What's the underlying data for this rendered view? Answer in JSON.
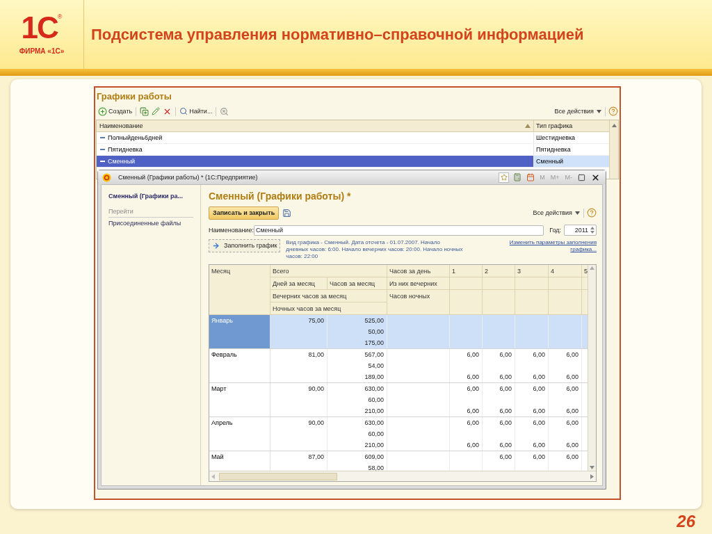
{
  "slide": {
    "logo_mark": "1С",
    "logo_registered": "®",
    "logo_caption": "ФИРМА «1С»",
    "title": "Подсистема управления нормативно–справочной информацией",
    "page_number": "26"
  },
  "list_form": {
    "title": "Графики работы",
    "toolbar": [
      [
        {
          "kind": "create",
          "label": "Создать"
        }
      ],
      [
        {
          "kind": "copy"
        },
        {
          "kind": "edit"
        },
        {
          "kind": "delete"
        }
      ],
      [
        {
          "kind": "find",
          "label": "Найти..."
        }
      ],
      [
        {
          "kind": "cancel_find"
        }
      ]
    ],
    "all_actions": "Все действия",
    "columns": [
      "Наименование",
      "Тип графика"
    ],
    "rows": [
      {
        "name": "Полныйдень6дней",
        "type": "Шестидневка",
        "selected": false
      },
      {
        "name": "Пятидневка",
        "type": "Пятидневка",
        "selected": false
      },
      {
        "name": "Сменный",
        "type": "Сменный",
        "selected": true
      }
    ]
  },
  "dialog": {
    "title": "Сменный (Графики работы) * (1С:Предприятие)",
    "tools": [
      {
        "kind": "favorite"
      },
      {
        "kind": "calculator"
      },
      {
        "kind": "calendar"
      },
      {
        "kind": "memory",
        "label": "M"
      },
      {
        "kind": "memory",
        "label": "M+"
      },
      {
        "kind": "memory",
        "label": "M-"
      },
      {
        "kind": "maximize"
      },
      {
        "kind": "close"
      }
    ],
    "nav": {
      "header": "Сменный (Графики ра...",
      "section": "Перейти",
      "links": [
        "Присоединенные файлы"
      ]
    },
    "form": {
      "heading": "Сменный (Графики работы) *",
      "save_close": "Записать и закрыть",
      "all_actions": "Все действия",
      "name_label": "Наименование:",
      "name_value": "Сменный",
      "year_label": "Год:",
      "year_value": "2011",
      "fill_button": "Заполнить график",
      "info": "Вид графика - Сменный. Дата отсчета - 01.07.2007. Начало дневных часов: 6:00. Начало вечерних часов: 20:00. Начало ночных часов: 22:00",
      "change_link": "Изменить параметры заполнения графика..."
    },
    "grid": {
      "header": {
        "month": "Месяц",
        "total": "Всего",
        "days": "Дней за месяц",
        "hours": "Часов за месяц",
        "evening_month": "Вечерних часов за месяц",
        "night_month": "Ночных часов за месяц",
        "per_day": "Часов за день",
        "evening": "Из них вечерних",
        "night": "Часов ночных",
        "day_columns": [
          "1",
          "2",
          "3",
          "4",
          "5"
        ]
      },
      "rows": [
        {
          "month": "Январь",
          "selected": true,
          "days": "75,00",
          "lines": [
            {
              "hours": "525,00"
            },
            {
              "hours": "50,00"
            },
            {
              "hours": "175,00"
            }
          ]
        },
        {
          "month": "Февраль",
          "selected": false,
          "days": "81,00",
          "lines": [
            {
              "hours": "567,00",
              "day": [
                "6,00",
                "6,00",
                "6,00",
                "6,00"
              ]
            },
            {
              "hours": "54,00"
            },
            {
              "hours": "189,00",
              "day": [
                "6,00",
                "6,00",
                "6,00",
                "6,00"
              ]
            }
          ]
        },
        {
          "month": "Март",
          "selected": false,
          "days": "90,00",
          "lines": [
            {
              "hours": "630,00",
              "day": [
                "6,00",
                "6,00",
                "6,00",
                "6,00"
              ]
            },
            {
              "hours": "60,00"
            },
            {
              "hours": "210,00",
              "day": [
                "6,00",
                "6,00",
                "6,00",
                "6,00"
              ]
            }
          ]
        },
        {
          "month": "Апрель",
          "selected": false,
          "days": "90,00",
          "lines": [
            {
              "hours": "630,00",
              "day": [
                "6,00",
                "6,00",
                "6,00",
                "6,00"
              ]
            },
            {
              "hours": "60,00"
            },
            {
              "hours": "210,00",
              "day": [
                "6,00",
                "6,00",
                "6,00",
                "6,00"
              ]
            }
          ]
        },
        {
          "month": "Май",
          "selected": false,
          "days": "87,00",
          "lines": [
            {
              "hours": "609,00",
              "leading_blank": true,
              "day": [
                "6,00",
                "6,00",
                "6,00"
              ]
            },
            {
              "hours": "58,00"
            }
          ]
        }
      ]
    }
  }
}
